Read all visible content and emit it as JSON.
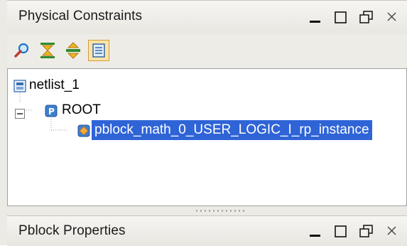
{
  "top_panel": {
    "title": "Physical Constraints",
    "controls": [
      "minimize-icon",
      "maximize-icon",
      "restore-icon",
      "close-icon"
    ]
  },
  "toolbar": {
    "tools": [
      {
        "icon": "search-icon"
      },
      {
        "icon": "collapse-all-icon"
      },
      {
        "icon": "expand-all-icon"
      },
      {
        "icon": "properties-icon",
        "active": true
      }
    ]
  },
  "tree": {
    "root_label": "netlist_1",
    "child_label": "ROOT",
    "leaf_label": "pblock_math_0_USER_LOGIC_I_rp_instance"
  },
  "bottom_panel": {
    "title": "Pblock Properties",
    "controls": [
      "minimize-icon",
      "maximize-icon",
      "restore-icon",
      "close-icon"
    ]
  },
  "colors": {
    "selection": "#2f64d7",
    "accent_icon": "#1e73c8"
  }
}
